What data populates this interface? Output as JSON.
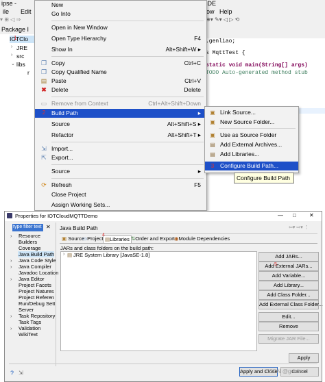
{
  "menubar": {
    "edit": "Edit",
    "window": "ow",
    "help": "Help",
    "title_frag": "ipse -",
    "title_right": "IDE"
  },
  "package_explorer": {
    "title": "Package I",
    "items": [
      "IOTClo",
      "JRE",
      "src",
      "libs",
      "r"
    ]
  },
  "editor": {
    "lines": [
      ".genliao;",
      "s MqttTest {",
      "static void main(String[] args)",
      "TODO Auto-generated method stub"
    ]
  },
  "context_menu": {
    "items": [
      {
        "label": "New",
        "shortcut": ""
      },
      {
        "label": "Go Into",
        "shortcut": ""
      },
      {
        "label": "Open in New Window",
        "shortcut": ""
      },
      {
        "label": "Open Type Hierarchy",
        "shortcut": "F4"
      },
      {
        "label": "Show In",
        "shortcut": "Alt+Shift+W ▸"
      },
      {
        "label": "Copy",
        "shortcut": "Ctrl+C"
      },
      {
        "label": "Copy Qualified Name",
        "shortcut": ""
      },
      {
        "label": "Paste",
        "shortcut": "Ctrl+V"
      },
      {
        "label": "Delete",
        "shortcut": "Delete"
      },
      {
        "label": "Remove from Context",
        "shortcut": "Ctrl+Alt+Shift+Down"
      },
      {
        "label": "Build Path",
        "shortcut": "▸"
      },
      {
        "label": "Source",
        "shortcut": "Alt+Shift+S ▸"
      },
      {
        "label": "Refactor",
        "shortcut": "Alt+Shift+T ▸"
      },
      {
        "label": "Import...",
        "shortcut": ""
      },
      {
        "label": "Export...",
        "shortcut": ""
      },
      {
        "label": "Source",
        "shortcut": "▸"
      },
      {
        "label": "Refresh",
        "shortcut": "F5"
      },
      {
        "label": "Close Project",
        "shortcut": ""
      },
      {
        "label": "Assign Working Sets...",
        "shortcut": ""
      }
    ]
  },
  "build_path_submenu": {
    "items": [
      "Link Source...",
      "New Source Folder...",
      "Use as Source Folder",
      "Add External Archives...",
      "Add Libraries...",
      "Configure Build Path..."
    ]
  },
  "tooltip": "Configure Build Path",
  "dialog": {
    "title": "Properties for IOTCloudMQTTDemo",
    "filter_placeholder": "type filter text",
    "nav_items": [
      "Resource",
      "Builders",
      "Coverage",
      "Java Build Path",
      "Java Code Style",
      "Java Compiler",
      "Javadoc Location",
      "Java Editor",
      "Project Facets",
      "Project Natures",
      "Project Referen",
      "Run/Debug Sett",
      "Server",
      "Task Repository",
      "Task Tags",
      "Validation",
      "WikiText"
    ],
    "page_title": "Java Build Path",
    "tabs": [
      "Source",
      "Projects",
      "Libraries",
      "Order and Export",
      "Module Dependencies"
    ],
    "jar_label": "JARs and class folders on the build path:",
    "libraries": [
      "JRE System Library [JavaSE-1.8]"
    ],
    "buttons": [
      "Add JARs...",
      "Add External JARs...",
      "Add Variable...",
      "Add Library...",
      "Add Class Folder...",
      "Add External Class Folder...",
      "Edit...",
      "Remove",
      "Migrate JAR File..."
    ],
    "apply": "Apply",
    "apply_close": "Apply and Close",
    "cancel": "Cancel",
    "watermark": "CSDN @genliao",
    "close_x": "✕",
    "minimize": "—",
    "maximize": "□"
  },
  "colors": {
    "highlight": "#1e50c8",
    "menu_bg": "#f2f2f2",
    "marker": "#e03030"
  }
}
